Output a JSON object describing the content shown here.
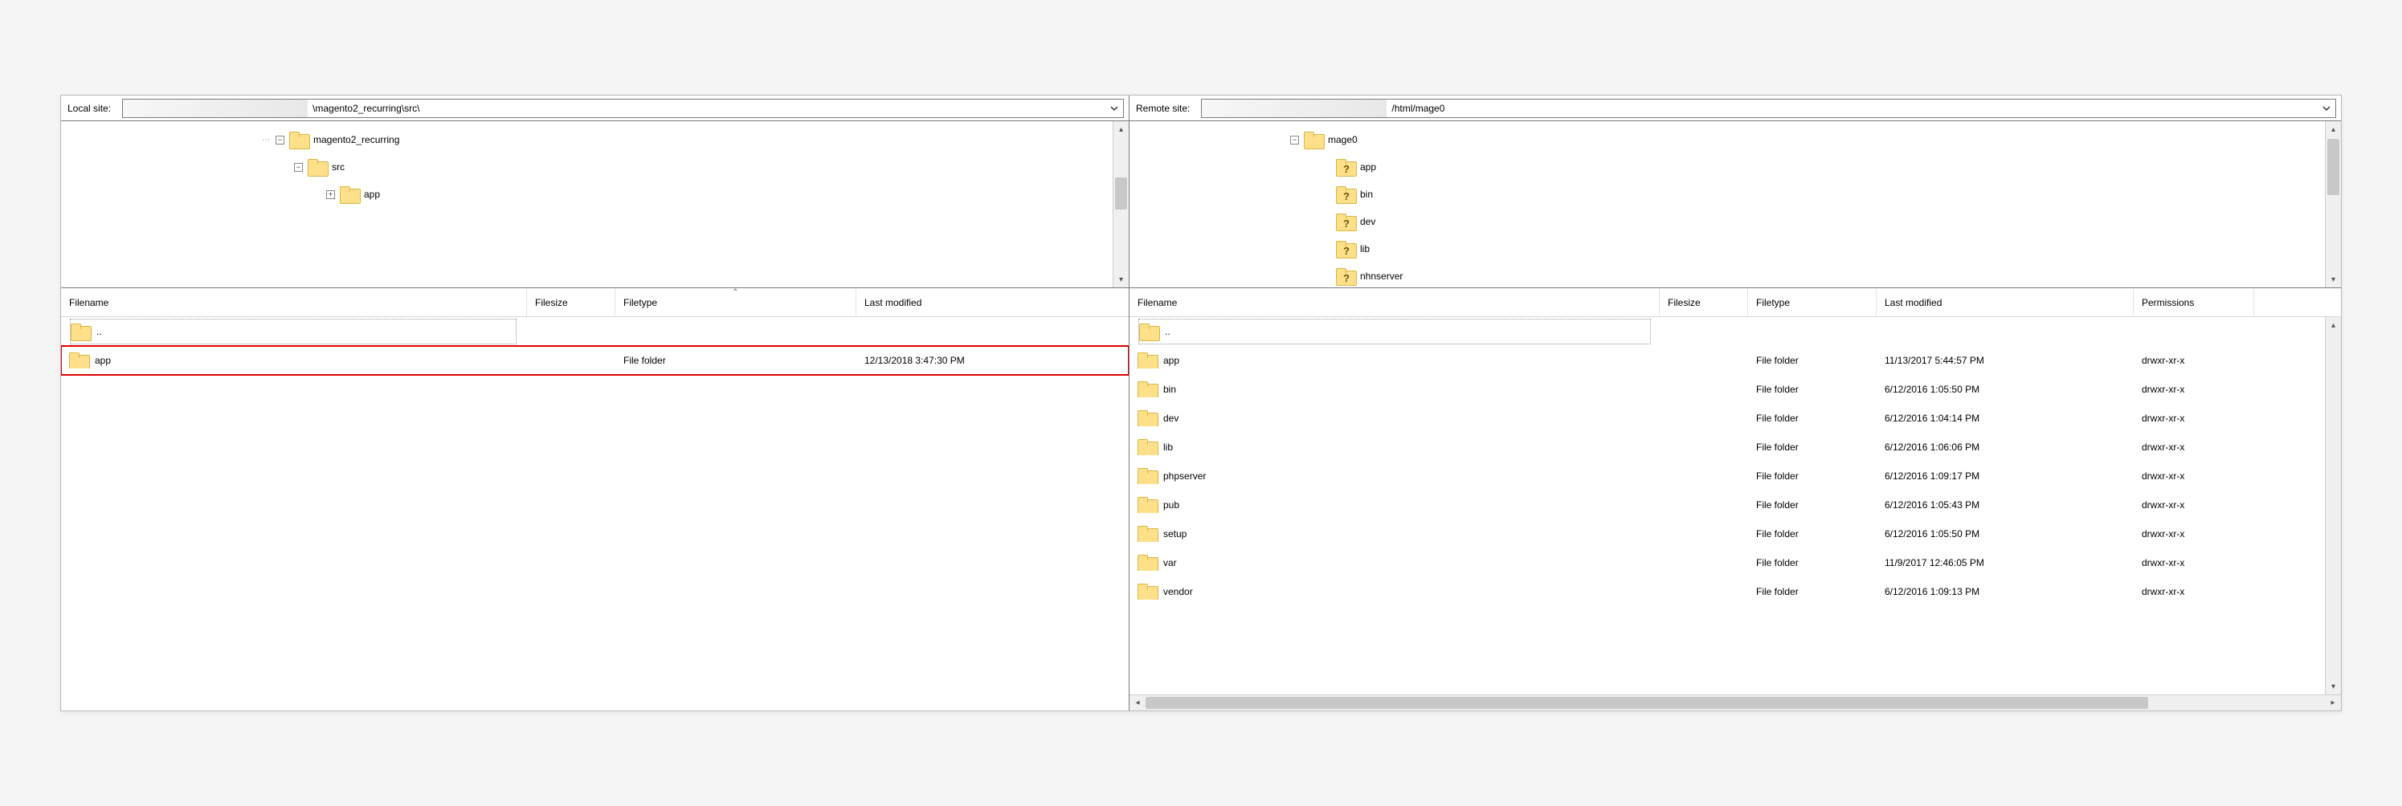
{
  "local": {
    "siteLabel": "Local site:",
    "path": "\\magento2_recurring\\src\\",
    "tree": [
      {
        "indent": 250,
        "hit": "−",
        "dots": "⋯",
        "label": "magento2_recurring",
        "q": false
      },
      {
        "indent": 290,
        "hit": "−",
        "dots": "",
        "label": "src",
        "q": false
      },
      {
        "indent": 330,
        "hit": "+",
        "dots": "",
        "label": "app",
        "q": false
      }
    ],
    "columns": {
      "name": "Filename",
      "size": "Filesize",
      "type": "Filetype",
      "date": "Last modified"
    },
    "rows": [
      {
        "name": "..",
        "size": "",
        "type": "",
        "date": "",
        "parent": true
      },
      {
        "name": "app",
        "size": "",
        "type": "File folder",
        "date": "12/13/2018 3:47:30 PM",
        "selected": true
      }
    ]
  },
  "remote": {
    "siteLabel": "Remote site:",
    "path": "/html/mage0",
    "tree": [
      {
        "indent": 200,
        "hit": "−",
        "dots": "",
        "label": "mage0",
        "q": false
      },
      {
        "indent": 240,
        "hit": "",
        "dots": "",
        "label": "app",
        "q": true
      },
      {
        "indent": 240,
        "hit": "",
        "dots": "",
        "label": "bin",
        "q": true
      },
      {
        "indent": 240,
        "hit": "",
        "dots": "",
        "label": "dev",
        "q": true
      },
      {
        "indent": 240,
        "hit": "",
        "dots": "",
        "label": "lib",
        "q": true
      },
      {
        "indent": 240,
        "hit": "",
        "dots": "",
        "label": "nhnserver",
        "q": true
      }
    ],
    "columns": {
      "name": "Filename",
      "size": "Filesize",
      "type": "Filetype",
      "date": "Last modified",
      "perm": "Permissions"
    },
    "rows": [
      {
        "name": "..",
        "size": "",
        "type": "",
        "date": "",
        "perm": "",
        "parent": true
      },
      {
        "name": "app",
        "size": "",
        "type": "File folder",
        "date": "11/13/2017 5:44:57 PM",
        "perm": "drwxr-xr-x"
      },
      {
        "name": "bin",
        "size": "",
        "type": "File folder",
        "date": "6/12/2016 1:05:50 PM",
        "perm": "drwxr-xr-x"
      },
      {
        "name": "dev",
        "size": "",
        "type": "File folder",
        "date": "6/12/2016 1:04:14 PM",
        "perm": "drwxr-xr-x"
      },
      {
        "name": "lib",
        "size": "",
        "type": "File folder",
        "date": "6/12/2016 1:06:06 PM",
        "perm": "drwxr-xr-x"
      },
      {
        "name": "phpserver",
        "size": "",
        "type": "File folder",
        "date": "6/12/2016 1:09:17 PM",
        "perm": "drwxr-xr-x"
      },
      {
        "name": "pub",
        "size": "",
        "type": "File folder",
        "date": "6/12/2016 1:05:43 PM",
        "perm": "drwxr-xr-x"
      },
      {
        "name": "setup",
        "size": "",
        "type": "File folder",
        "date": "6/12/2016 1:05:50 PM",
        "perm": "drwxr-xr-x"
      },
      {
        "name": "var",
        "size": "",
        "type": "File folder",
        "date": "11/9/2017 12:46:05 PM",
        "perm": "drwxr-xr-x"
      },
      {
        "name": "vendor",
        "size": "",
        "type": "File folder",
        "date": "6/12/2016 1:09:13 PM",
        "perm": "drwxr-xr-x"
      }
    ]
  }
}
